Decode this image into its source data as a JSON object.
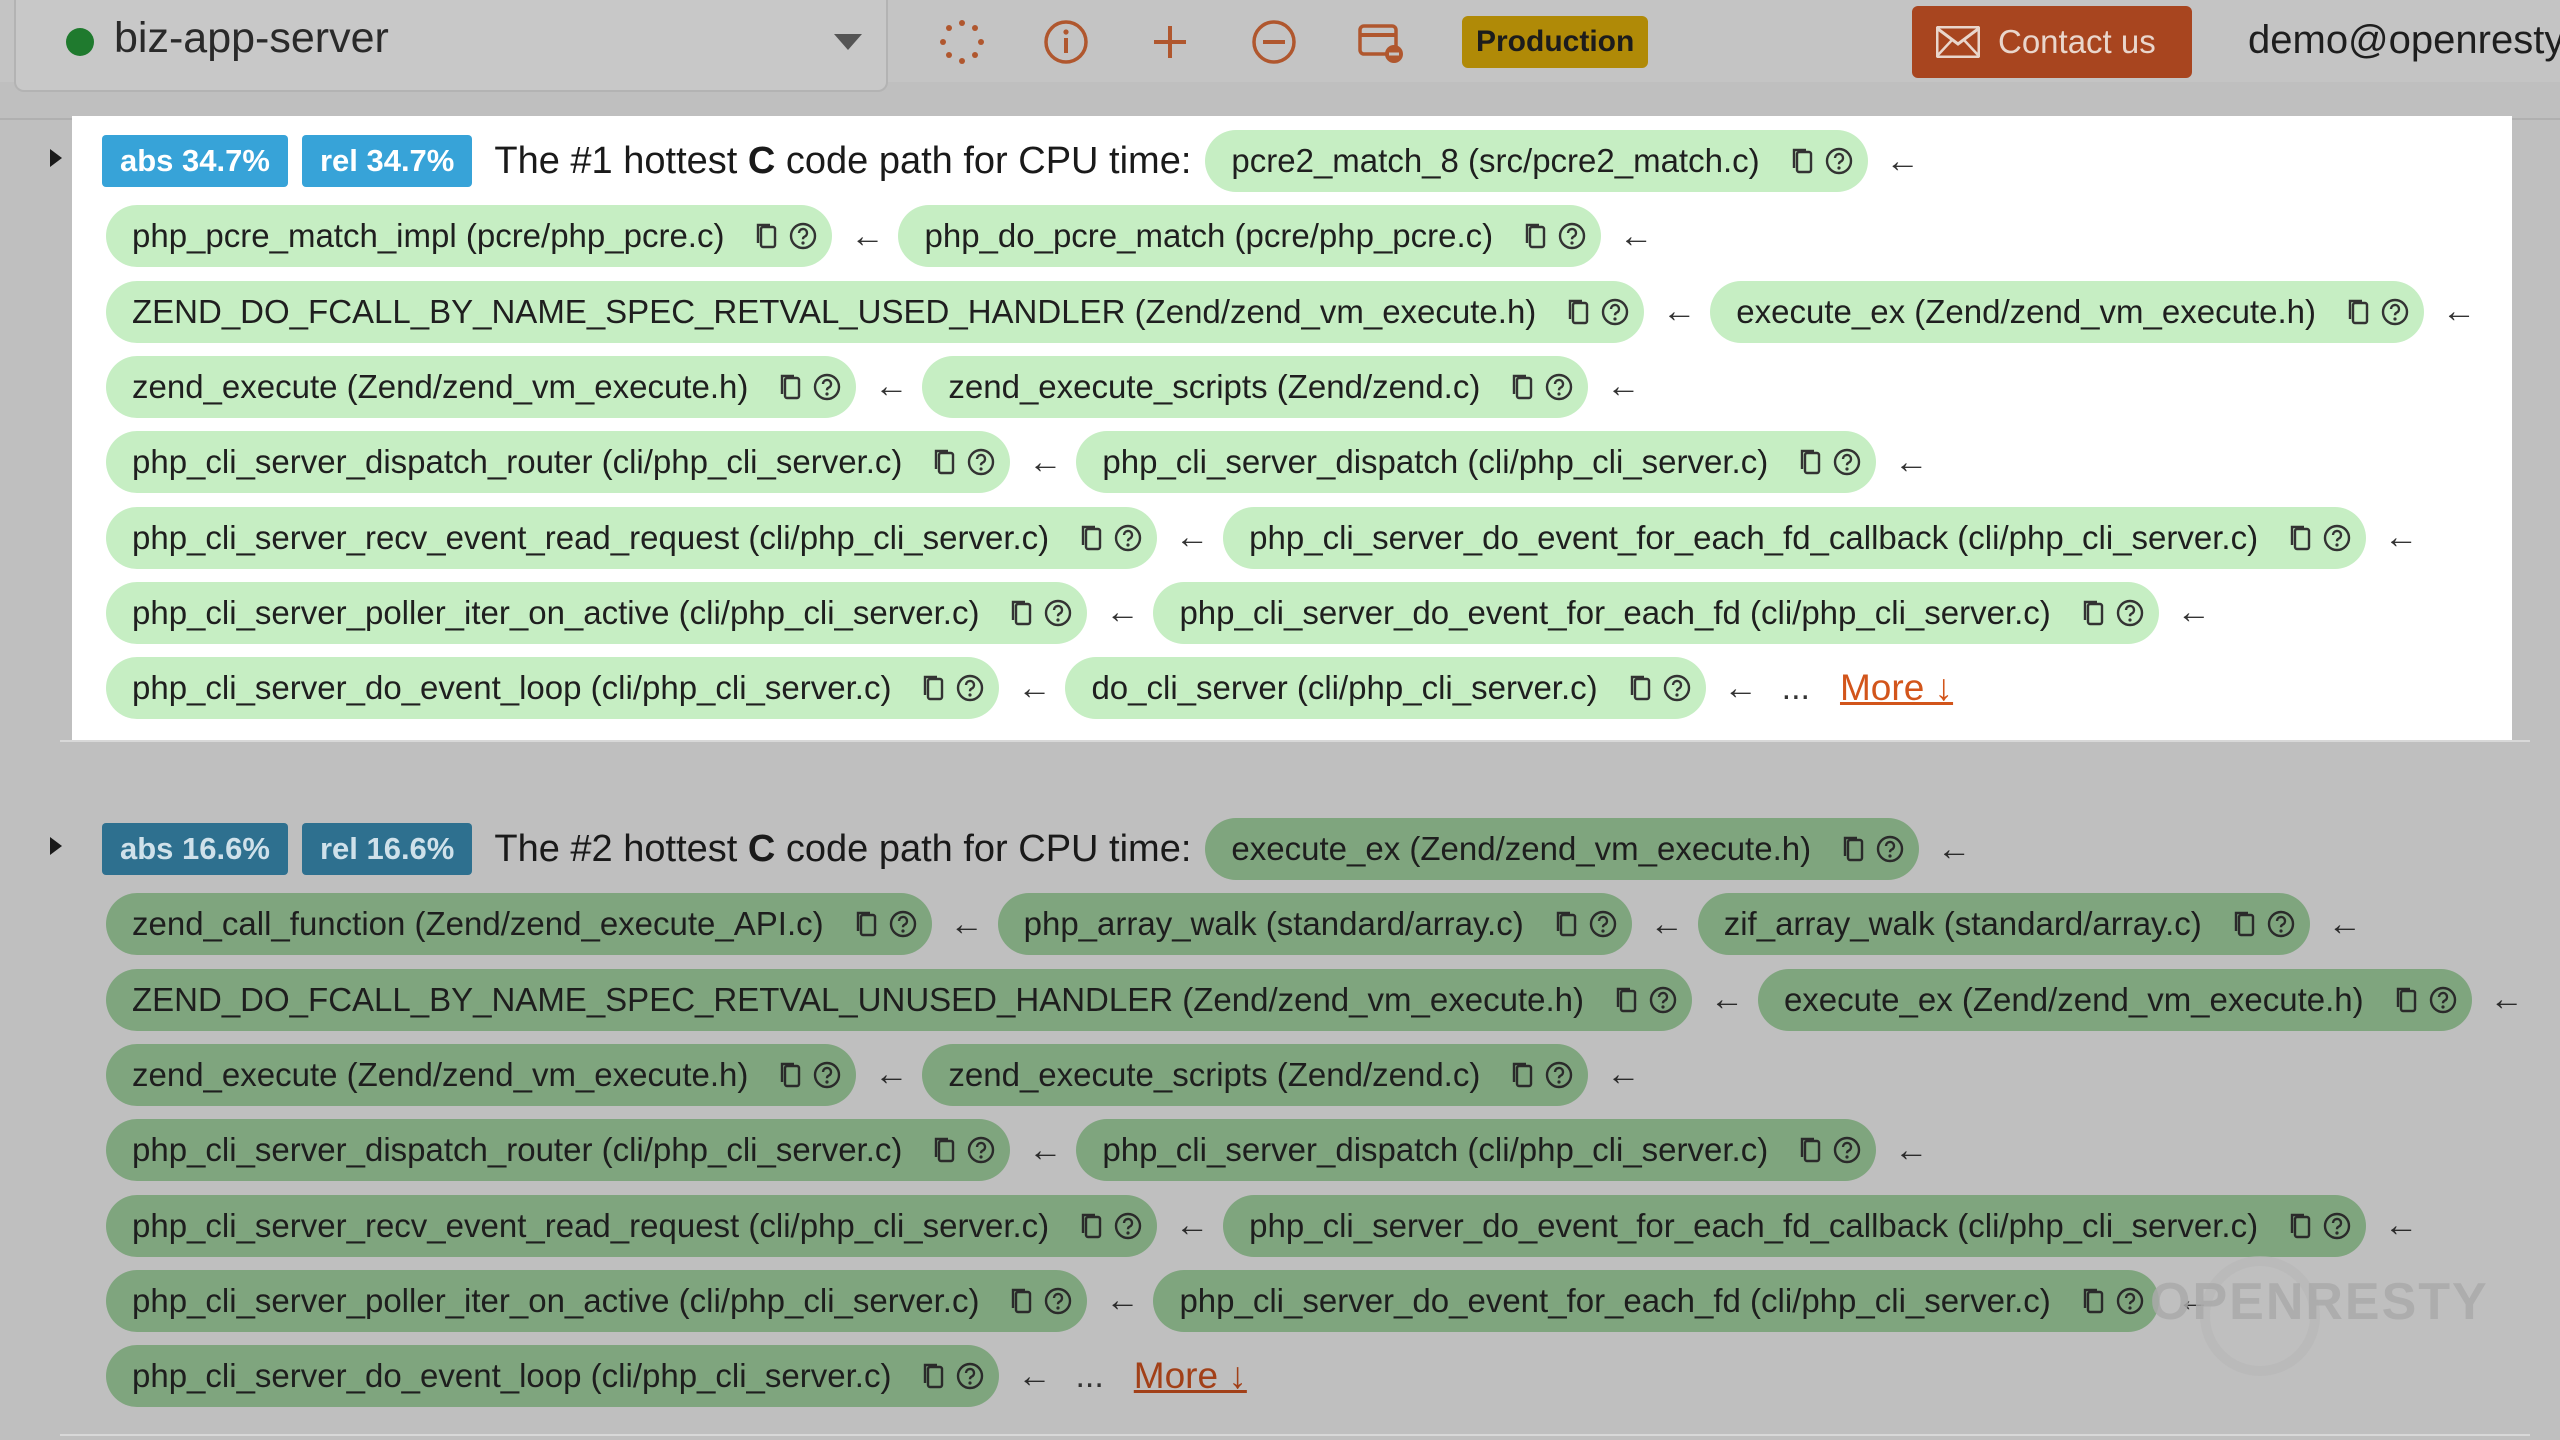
{
  "header": {
    "server_name": "biz-app-server",
    "environment_badge": "Production",
    "contact_label": "Contact us",
    "user_email": "demo@openresty",
    "icons": [
      "spinner-icon",
      "info-icon",
      "plus-icon",
      "minus-circle-icon",
      "card-remove-icon",
      "mail-icon"
    ]
  },
  "paths": [
    {
      "abs": "abs 34.7%",
      "rel": "rel 34.7%",
      "heading_prefix": "The #1 hottest",
      "heading_lang": "C",
      "heading_suffix": "code path for CPU time:",
      "more_label": "More ↓",
      "ellipsis": "...",
      "rows": [
        [
          "pcre2_match_8 (src/pcre2_match.c)"
        ],
        [
          "php_pcre_match_impl (pcre/php_pcre.c)",
          "php_do_pcre_match (pcre/php_pcre.c)"
        ],
        [
          "ZEND_DO_FCALL_BY_NAME_SPEC_RETVAL_USED_HANDLER (Zend/zend_vm_execute.h)",
          "execute_ex (Zend/zend_vm_execute.h)"
        ],
        [
          "zend_execute (Zend/zend_vm_execute.h)",
          "zend_execute_scripts (Zend/zend.c)"
        ],
        [
          "php_cli_server_dispatch_router (cli/php_cli_server.c)",
          "php_cli_server_dispatch (cli/php_cli_server.c)"
        ],
        [
          "php_cli_server_recv_event_read_request (cli/php_cli_server.c)",
          "php_cli_server_do_event_for_each_fd_callback (cli/php_cli_server.c)"
        ],
        [
          "php_cli_server_poller_iter_on_active (cli/php_cli_server.c)",
          "php_cli_server_do_event_for_each_fd (cli/php_cli_server.c)"
        ],
        [
          "php_cli_server_do_event_loop (cli/php_cli_server.c)",
          "do_cli_server (cli/php_cli_server.c)"
        ]
      ]
    },
    {
      "abs": "abs 16.6%",
      "rel": "rel 16.6%",
      "heading_prefix": "The #2 hottest",
      "heading_lang": "C",
      "heading_suffix": "code path for CPU time:",
      "more_label": "More ↓",
      "ellipsis": "...",
      "rows": [
        [
          "execute_ex (Zend/zend_vm_execute.h)"
        ],
        [
          "zend_call_function (Zend/zend_execute_API.c)",
          "php_array_walk (standard/array.c)",
          "zif_array_walk (standard/array.c)"
        ],
        [
          "ZEND_DO_FCALL_BY_NAME_SPEC_RETVAL_UNUSED_HANDLER (Zend/zend_vm_execute.h)",
          "execute_ex (Zend/zend_vm_execute.h)"
        ],
        [
          "zend_execute (Zend/zend_vm_execute.h)",
          "zend_execute_scripts (Zend/zend.c)"
        ],
        [
          "php_cli_server_dispatch_router (cli/php_cli_server.c)",
          "php_cli_server_dispatch (cli/php_cli_server.c)"
        ],
        [
          "php_cli_server_recv_event_read_request (cli/php_cli_server.c)",
          "php_cli_server_do_event_for_each_fd_callback (cli/php_cli_server.c)"
        ],
        [
          "php_cli_server_poller_iter_on_active (cli/php_cli_server.c)",
          "php_cli_server_do_event_for_each_fd (cli/php_cli_server.c)"
        ],
        [
          "php_cli_server_do_event_loop (cli/php_cli_server.c)"
        ]
      ]
    }
  ],
  "watermark": "OPENRESTY"
}
